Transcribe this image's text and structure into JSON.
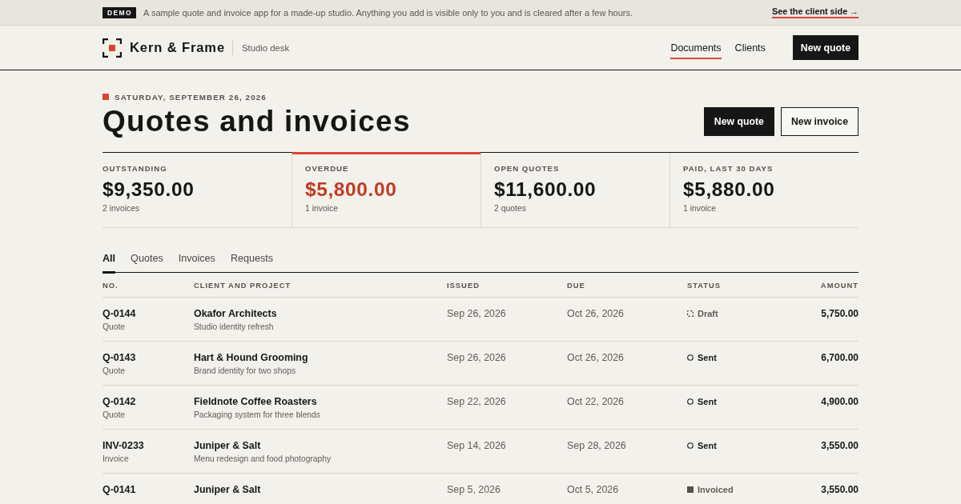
{
  "banner": {
    "badge": "DEMO",
    "message": "A sample quote and invoice app for a made-up studio. Anything you add is visible only to you and is cleared after a few hours.",
    "link": "See the client side →"
  },
  "header": {
    "brand": "Kern & Frame",
    "subtitle": "Studio desk",
    "nav": [
      {
        "label": "Documents",
        "selected": true
      },
      {
        "label": "Clients",
        "selected": false
      }
    ],
    "action": "New quote"
  },
  "page": {
    "date": "SATURDAY, SEPTEMBER 26, 2026",
    "title": "Quotes and invoices",
    "actions": [
      {
        "label": "New quote",
        "kind": "primary"
      },
      {
        "label": "New invoice",
        "kind": "secondary"
      }
    ]
  },
  "stats": [
    {
      "label": "OUTSTANDING",
      "value": "$9,350.00",
      "note": "2 invoices",
      "alert": false
    },
    {
      "label": "OVERDUE",
      "value": "$5,800.00",
      "note": "1 invoice",
      "alert": true
    },
    {
      "label": "OPEN QUOTES",
      "value": "$11,600.00",
      "note": "2 quotes",
      "alert": false
    },
    {
      "label": "PAID, LAST 30 DAYS",
      "value": "$5,880.00",
      "note": "1 invoice",
      "alert": false
    }
  ],
  "tabs": [
    {
      "label": "All",
      "selected": true
    },
    {
      "label": "Quotes",
      "selected": false
    },
    {
      "label": "Invoices",
      "selected": false
    },
    {
      "label": "Requests",
      "selected": false
    }
  ],
  "table": {
    "columns": [
      "NO.",
      "CLIENT AND PROJECT",
      "ISSUED",
      "DUE",
      "STATUS",
      "AMOUNT"
    ],
    "rows": [
      {
        "number": "Q-0144",
        "type": "Quote",
        "client": "Okafor Architects",
        "project": "Studio identity refresh",
        "issued": "Sep 26, 2026",
        "due": "Oct 26, 2026",
        "status": {
          "kind": "draft",
          "label": "Draft"
        },
        "amount": "5,750.00"
      },
      {
        "number": "Q-0143",
        "type": "Quote",
        "client": "Hart & Hound Grooming",
        "project": "Brand identity for two shops",
        "issued": "Sep 26, 2026",
        "due": "Oct 26, 2026",
        "status": {
          "kind": "sent",
          "label": "Sent"
        },
        "amount": "6,700.00"
      },
      {
        "number": "Q-0142",
        "type": "Quote",
        "client": "Fieldnote Coffee Roasters",
        "project": "Packaging system for three blends",
        "issued": "Sep 22, 2026",
        "due": "Oct 22, 2026",
        "status": {
          "kind": "sent",
          "label": "Sent"
        },
        "amount": "4,900.00"
      },
      {
        "number": "INV-0233",
        "type": "Invoice",
        "client": "Juniper & Salt",
        "project": "Menu redesign and food photography",
        "issued": "Sep 14, 2026",
        "due": "Sep 28, 2026",
        "status": {
          "kind": "sent",
          "label": "Sent"
        },
        "amount": "3,550.00"
      },
      {
        "number": "Q-0141",
        "client": "Juniper & Salt",
        "issued": "Sep 5, 2026",
        "due": "Oct 5, 2026",
        "status": {
          "kind": "invoiced",
          "label": "Invoiced"
        },
        "amount": "3,550.00"
      }
    ]
  }
}
